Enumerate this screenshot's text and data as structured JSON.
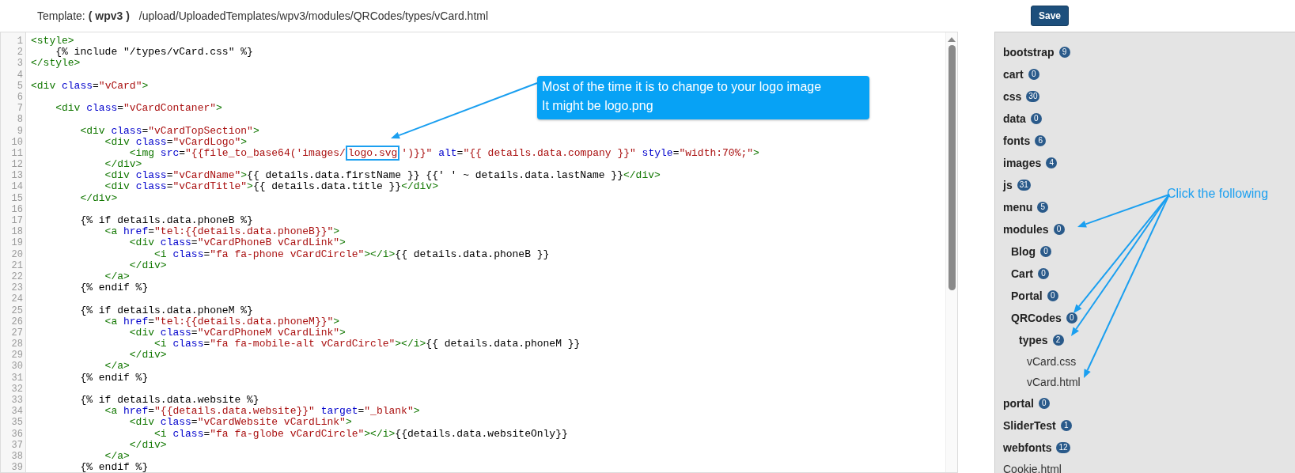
{
  "header": {
    "label": "Template:",
    "template": "( wpv3 )",
    "path": "/upload/UploadedTemplates/wpv3/modules/QRCodes/types/vCard.html",
    "save_button": "Save"
  },
  "editor": {
    "lines": [
      {
        "number": "1",
        "tokens": [
          {
            "kind": "tag",
            "text": "<style>"
          }
        ]
      },
      {
        "number": "2",
        "tokens": [
          {
            "kind": "text",
            "text": "    {% include \"/types/vCard.css\" %}"
          }
        ]
      },
      {
        "number": "3",
        "tokens": [
          {
            "kind": "tag",
            "text": "</style>"
          }
        ]
      },
      {
        "number": "4"
      },
      {
        "number": "5",
        "tokens": [
          {
            "kind": "tag",
            "text": "<div"
          },
          {
            "kind": "attr",
            "text": " class"
          },
          {
            "kind": "text",
            "text": "="
          },
          {
            "kind": "string",
            "text": "\"vCard\""
          },
          {
            "kind": "tag",
            "text": ">"
          }
        ]
      },
      {
        "number": "6"
      },
      {
        "number": "7",
        "tokens": [
          {
            "kind": "tag",
            "text": "    <div"
          },
          {
            "kind": "attr",
            "text": " class"
          },
          {
            "kind": "text",
            "text": "="
          },
          {
            "kind": "string",
            "text": "\"vCardContaner\""
          },
          {
            "kind": "tag",
            "text": ">"
          }
        ]
      },
      {
        "number": "8"
      },
      {
        "number": "9",
        "tokens": [
          {
            "kind": "tag",
            "text": "        <div"
          },
          {
            "kind": "attr",
            "text": " class"
          },
          {
            "kind": "text",
            "text": "="
          },
          {
            "kind": "string",
            "text": "\"vCardTopSection\""
          },
          {
            "kind": "tag",
            "text": ">"
          }
        ]
      },
      {
        "number": "10",
        "tokens": [
          {
            "kind": "tag",
            "text": "            <div"
          },
          {
            "kind": "attr",
            "text": " class"
          },
          {
            "kind": "text",
            "text": "="
          },
          {
            "kind": "string",
            "text": "\"vCardLogo\""
          },
          {
            "kind": "tag",
            "text": ">"
          }
        ]
      },
      {
        "number": "11",
        "tokens": [
          {
            "kind": "tag",
            "text": "                <img"
          },
          {
            "kind": "attr",
            "text": " src"
          },
          {
            "kind": "text",
            "text": "="
          },
          {
            "kind": "string",
            "text": "\"{{file_to_base64('images/"
          },
          {
            "kind": "string",
            "text": "logo.svg",
            "boxed": true
          },
          {
            "kind": "string",
            "text": "')}}\""
          },
          {
            "kind": "attr",
            "text": " alt"
          },
          {
            "kind": "text",
            "text": "="
          },
          {
            "kind": "string",
            "text": "\"{{ details.data.company }}\""
          },
          {
            "kind": "attr",
            "text": " style"
          },
          {
            "kind": "text",
            "text": "="
          },
          {
            "kind": "string",
            "text": "\"width:70%;\""
          },
          {
            "kind": "tag",
            "text": ">"
          }
        ]
      },
      {
        "number": "12",
        "tokens": [
          {
            "kind": "tag",
            "text": "            </div>"
          }
        ]
      },
      {
        "number": "13",
        "tokens": [
          {
            "kind": "tag",
            "text": "            <div"
          },
          {
            "kind": "attr",
            "text": " class"
          },
          {
            "kind": "text",
            "text": "="
          },
          {
            "kind": "string",
            "text": "\"vCardName\""
          },
          {
            "kind": "tag",
            "text": ">"
          },
          {
            "kind": "text",
            "text": "{{ details.data.firstName }} {{' ' ~ details.data.lastName }}"
          },
          {
            "kind": "tag",
            "text": "</div>"
          }
        ]
      },
      {
        "number": "14",
        "tokens": [
          {
            "kind": "tag",
            "text": "            <div"
          },
          {
            "kind": "attr",
            "text": " class"
          },
          {
            "kind": "text",
            "text": "="
          },
          {
            "kind": "string",
            "text": "\"vCardTitle\""
          },
          {
            "kind": "tag",
            "text": ">"
          },
          {
            "kind": "text",
            "text": "{{ details.data.title }}"
          },
          {
            "kind": "tag",
            "text": "</div>"
          }
        ]
      },
      {
        "number": "15",
        "tokens": [
          {
            "kind": "tag",
            "text": "        </div>"
          }
        ]
      },
      {
        "number": "16"
      },
      {
        "number": "17",
        "tokens": [
          {
            "kind": "text",
            "text": "        {% if details.data.phoneB %}"
          }
        ]
      },
      {
        "number": "18",
        "tokens": [
          {
            "kind": "tag",
            "text": "            <a"
          },
          {
            "kind": "attr",
            "text": " href"
          },
          {
            "kind": "text",
            "text": "="
          },
          {
            "kind": "string",
            "text": "\"tel:{{details.data.phoneB}}\""
          },
          {
            "kind": "tag",
            "text": ">"
          }
        ]
      },
      {
        "number": "19",
        "tokens": [
          {
            "kind": "tag",
            "text": "                <div"
          },
          {
            "kind": "attr",
            "text": " class"
          },
          {
            "kind": "text",
            "text": "="
          },
          {
            "kind": "string",
            "text": "\"vCardPhoneB vCardLink\""
          },
          {
            "kind": "tag",
            "text": ">"
          }
        ]
      },
      {
        "number": "20",
        "tokens": [
          {
            "kind": "tag",
            "text": "                    <i"
          },
          {
            "kind": "attr",
            "text": " class"
          },
          {
            "kind": "text",
            "text": "="
          },
          {
            "kind": "string",
            "text": "\"fa fa-phone vCardCircle\""
          },
          {
            "kind": "tag",
            "text": "></i>"
          },
          {
            "kind": "text",
            "text": "{{ details.data.phoneB }}"
          }
        ]
      },
      {
        "number": "21",
        "tokens": [
          {
            "kind": "tag",
            "text": "                </div>"
          }
        ]
      },
      {
        "number": "22",
        "tokens": [
          {
            "kind": "tag",
            "text": "            </a>"
          }
        ]
      },
      {
        "number": "23",
        "tokens": [
          {
            "kind": "text",
            "text": "        {% endif %}"
          }
        ]
      },
      {
        "number": "24"
      },
      {
        "number": "25",
        "tokens": [
          {
            "kind": "text",
            "text": "        {% if details.data.phoneM %}"
          }
        ]
      },
      {
        "number": "26",
        "tokens": [
          {
            "kind": "tag",
            "text": "            <a"
          },
          {
            "kind": "attr",
            "text": " href"
          },
          {
            "kind": "text",
            "text": "="
          },
          {
            "kind": "string",
            "text": "\"tel:{{details.data.phoneM}}\""
          },
          {
            "kind": "tag",
            "text": ">"
          }
        ]
      },
      {
        "number": "27",
        "tokens": [
          {
            "kind": "tag",
            "text": "                <div"
          },
          {
            "kind": "attr",
            "text": " class"
          },
          {
            "kind": "text",
            "text": "="
          },
          {
            "kind": "string",
            "text": "\"vCardPhoneM vCardLink\""
          },
          {
            "kind": "tag",
            "text": ">"
          }
        ]
      },
      {
        "number": "28",
        "tokens": [
          {
            "kind": "tag",
            "text": "                    <i"
          },
          {
            "kind": "attr",
            "text": " class"
          },
          {
            "kind": "text",
            "text": "="
          },
          {
            "kind": "string",
            "text": "\"fa fa-mobile-alt vCardCircle\""
          },
          {
            "kind": "tag",
            "text": "></i>"
          },
          {
            "kind": "text",
            "text": "{{ details.data.phoneM }}"
          }
        ]
      },
      {
        "number": "29",
        "tokens": [
          {
            "kind": "tag",
            "text": "                </div>"
          }
        ]
      },
      {
        "number": "30",
        "tokens": [
          {
            "kind": "tag",
            "text": "            </a>"
          }
        ]
      },
      {
        "number": "31",
        "tokens": [
          {
            "kind": "text",
            "text": "        {% endif %}"
          }
        ]
      },
      {
        "number": "32"
      },
      {
        "number": "33",
        "tokens": [
          {
            "kind": "text",
            "text": "        {% if details.data.website %}"
          }
        ]
      },
      {
        "number": "34",
        "tokens": [
          {
            "kind": "tag",
            "text": "            <a"
          },
          {
            "kind": "attr",
            "text": " href"
          },
          {
            "kind": "text",
            "text": "="
          },
          {
            "kind": "string",
            "text": "\"{{details.data.website}}\""
          },
          {
            "kind": "attr",
            "text": " target"
          },
          {
            "kind": "text",
            "text": "="
          },
          {
            "kind": "string",
            "text": "\"_blank\""
          },
          {
            "kind": "tag",
            "text": ">"
          }
        ]
      },
      {
        "number": "35",
        "tokens": [
          {
            "kind": "tag",
            "text": "                <div"
          },
          {
            "kind": "attr",
            "text": " class"
          },
          {
            "kind": "text",
            "text": "="
          },
          {
            "kind": "string",
            "text": "\"vCardWebsite vCardLink\""
          },
          {
            "kind": "tag",
            "text": ">"
          }
        ]
      },
      {
        "number": "36",
        "tokens": [
          {
            "kind": "tag",
            "text": "                    <i"
          },
          {
            "kind": "attr",
            "text": " class"
          },
          {
            "kind": "text",
            "text": "="
          },
          {
            "kind": "string",
            "text": "\"fa fa-globe vCardCircle\""
          },
          {
            "kind": "tag",
            "text": "></i>"
          },
          {
            "kind": "text",
            "text": "{{details.data.websiteOnly}}"
          }
        ]
      },
      {
        "number": "37",
        "tokens": [
          {
            "kind": "tag",
            "text": "                </div>"
          }
        ]
      },
      {
        "number": "38",
        "tokens": [
          {
            "kind": "tag",
            "text": "            </a>"
          }
        ]
      },
      {
        "number": "39",
        "tokens": [
          {
            "kind": "text",
            "text": "        {% endif %}"
          }
        ]
      }
    ]
  },
  "sidebar": {
    "items": [
      {
        "kind": "folder",
        "name": "bootstrap",
        "count": "9"
      },
      {
        "kind": "folder",
        "name": "cart",
        "count": "0"
      },
      {
        "kind": "folder",
        "name": "css",
        "count": "30"
      },
      {
        "kind": "folder",
        "name": "data",
        "count": "0"
      },
      {
        "kind": "folder",
        "name": "fonts",
        "count": "6"
      },
      {
        "kind": "folder",
        "name": "images",
        "count": "4"
      },
      {
        "kind": "folder",
        "name": "js",
        "count": "31"
      },
      {
        "kind": "folder",
        "name": "menu",
        "count": "5"
      },
      {
        "kind": "folder",
        "name": "modules",
        "count": "0",
        "children": [
          {
            "kind": "folder",
            "name": "Blog",
            "count": "0"
          },
          {
            "kind": "folder",
            "name": "Cart",
            "count": "0"
          },
          {
            "kind": "folder",
            "name": "Portal",
            "count": "0"
          },
          {
            "kind": "folder",
            "name": "QRCodes",
            "count": "0",
            "children": [
              {
                "kind": "folder",
                "name": "types",
                "count": "2",
                "children": [
                  {
                    "kind": "file",
                    "name": "vCard.css"
                  },
                  {
                    "kind": "file",
                    "name": "vCard.html"
                  }
                ]
              }
            ]
          }
        ]
      },
      {
        "kind": "folder",
        "name": "portal",
        "count": "0"
      },
      {
        "kind": "folder",
        "name": "SliderTest",
        "count": "1"
      },
      {
        "kind": "folder",
        "name": "webfonts",
        "count": "12"
      },
      {
        "kind": "file",
        "name": "Cookie.html"
      }
    ]
  },
  "annotations": {
    "callout": [
      "Most of the time it is to change to your logo image",
      "It might be logo.png"
    ],
    "label": "Click the following"
  }
}
